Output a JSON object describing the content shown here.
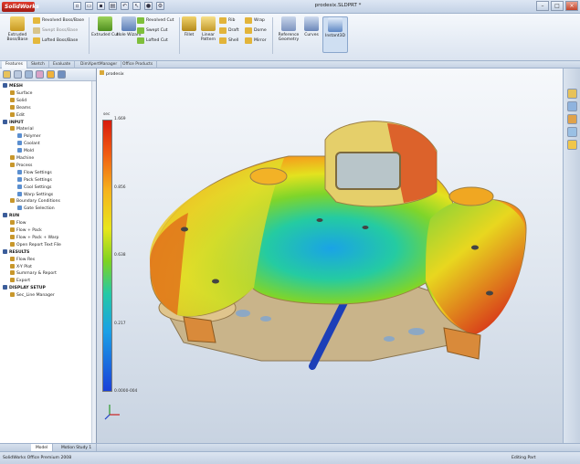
{
  "app": {
    "logo_text": "SolidWorks",
    "document_title": "prodesix.SLDPRT *"
  },
  "window_controls": {
    "minimize": "–",
    "maximize": "□",
    "close": "×"
  },
  "ribbon": {
    "big_buttons": [
      {
        "label": "Extruded Boss/Base",
        "icon": "extrude-boss-icon"
      },
      {
        "label": "Extruded Cut",
        "icon": "extrude-cut-icon"
      },
      {
        "label": "Hole Wizard",
        "icon": "hole-wizard-icon"
      },
      {
        "label": "Fillet",
        "icon": "fillet-icon"
      },
      {
        "label": "Linear Pattern",
        "icon": "linear-pattern-icon"
      },
      {
        "label": "Reference Geometry",
        "icon": "reference-geometry-icon"
      },
      {
        "label": "Curves",
        "icon": "curves-icon"
      },
      {
        "label": "Instant3D",
        "icon": "instant3d-icon"
      }
    ],
    "small_buttons": {
      "col1": [
        "Revolved Boss/Base",
        "Swept Boss/Base",
        "Lofted Boss/Base"
      ],
      "col2": [
        "Revolved Cut",
        "Swept Cut",
        "Lofted Cut"
      ],
      "col3": [
        "Rib",
        "Draft",
        "Shell"
      ],
      "col4": [
        "Wrap",
        "Dome",
        "Mirror"
      ]
    }
  },
  "ribbon_tabs": [
    "Features",
    "Sketch",
    "Evaluate",
    "DimXpertManager",
    "Office Products"
  ],
  "panel": {
    "tree": [
      {
        "label": "MESH",
        "level": 0,
        "header": true,
        "icon": "mesh-icon"
      },
      {
        "label": "Surface",
        "level": 1,
        "icon": "surface-icon"
      },
      {
        "label": "Solid",
        "level": 1,
        "icon": "solid-icon"
      },
      {
        "label": "Beams",
        "level": 1,
        "icon": "beams-icon"
      },
      {
        "label": "Edit",
        "level": 1,
        "icon": "edit-icon"
      },
      {
        "label": "INPUT",
        "level": 0,
        "header": true,
        "icon": "input-icon"
      },
      {
        "label": "Material",
        "level": 1,
        "icon": "material-icon"
      },
      {
        "label": "Polymer",
        "level": 2,
        "icon": "polymer-icon"
      },
      {
        "label": "Coolant",
        "level": 2,
        "icon": "coolant-icon"
      },
      {
        "label": "Mold",
        "level": 2,
        "icon": "mold-icon"
      },
      {
        "label": "Machine",
        "level": 1,
        "icon": "machine-icon"
      },
      {
        "label": "Process",
        "level": 1,
        "icon": "process-icon"
      },
      {
        "label": "Flow Settings",
        "level": 2,
        "icon": "settings-icon"
      },
      {
        "label": "Pack Settings",
        "level": 2,
        "icon": "settings-icon"
      },
      {
        "label": "Cool Settings",
        "level": 2,
        "icon": "settings-icon"
      },
      {
        "label": "Warp Settings",
        "level": 2,
        "icon": "settings-icon"
      },
      {
        "label": "Boundary Conditions",
        "level": 1,
        "icon": "boundary-icon"
      },
      {
        "label": "Gate Selection",
        "level": 2,
        "icon": "gate-icon"
      },
      {
        "label": "RUN",
        "level": 0,
        "header": true,
        "icon": "run-icon"
      },
      {
        "label": "Flow",
        "level": 1,
        "icon": "flow-icon"
      },
      {
        "label": "Flow + Pack",
        "level": 1,
        "icon": "flow-pack-icon"
      },
      {
        "label": "Flow + Pack + Warp",
        "level": 1,
        "icon": "flow-pack-warp-icon"
      },
      {
        "label": "Open Report Text File",
        "level": 1,
        "icon": "report-file-icon"
      },
      {
        "label": "RESULTS",
        "level": 0,
        "header": true,
        "icon": "results-icon"
      },
      {
        "label": "Flow Res",
        "level": 1,
        "icon": "flow-results-icon"
      },
      {
        "label": "X-Y Plot",
        "level": 1,
        "icon": "xy-plot-icon"
      },
      {
        "label": "Summary & Report",
        "level": 1,
        "icon": "summary-icon"
      },
      {
        "label": "Export",
        "level": 1,
        "icon": "export-icon"
      },
      {
        "label": "DISPLAY SETUP",
        "level": 0,
        "header": true,
        "icon": "display-setup-icon"
      },
      {
        "label": "Sec_Line Manager",
        "level": 1,
        "icon": "line-manager-icon"
      }
    ]
  },
  "viewport": {
    "tree_root": "prodesix",
    "legend": {
      "title": "sec",
      "ticks": [
        "1.669",
        "0.856",
        "0.638",
        "0.217",
        "0.0000-004"
      ],
      "tick_fractions": [
        1.0,
        0.75,
        0.5,
        0.25,
        0.0
      ]
    }
  },
  "bottom_tabs": [
    "Model",
    "Motion Study 1"
  ],
  "status": {
    "left": "SolidWorks Office Premium 2008",
    "right": "Editing Part"
  },
  "colors": {
    "accent": "#d7271a",
    "selection": "#3d73c7"
  }
}
